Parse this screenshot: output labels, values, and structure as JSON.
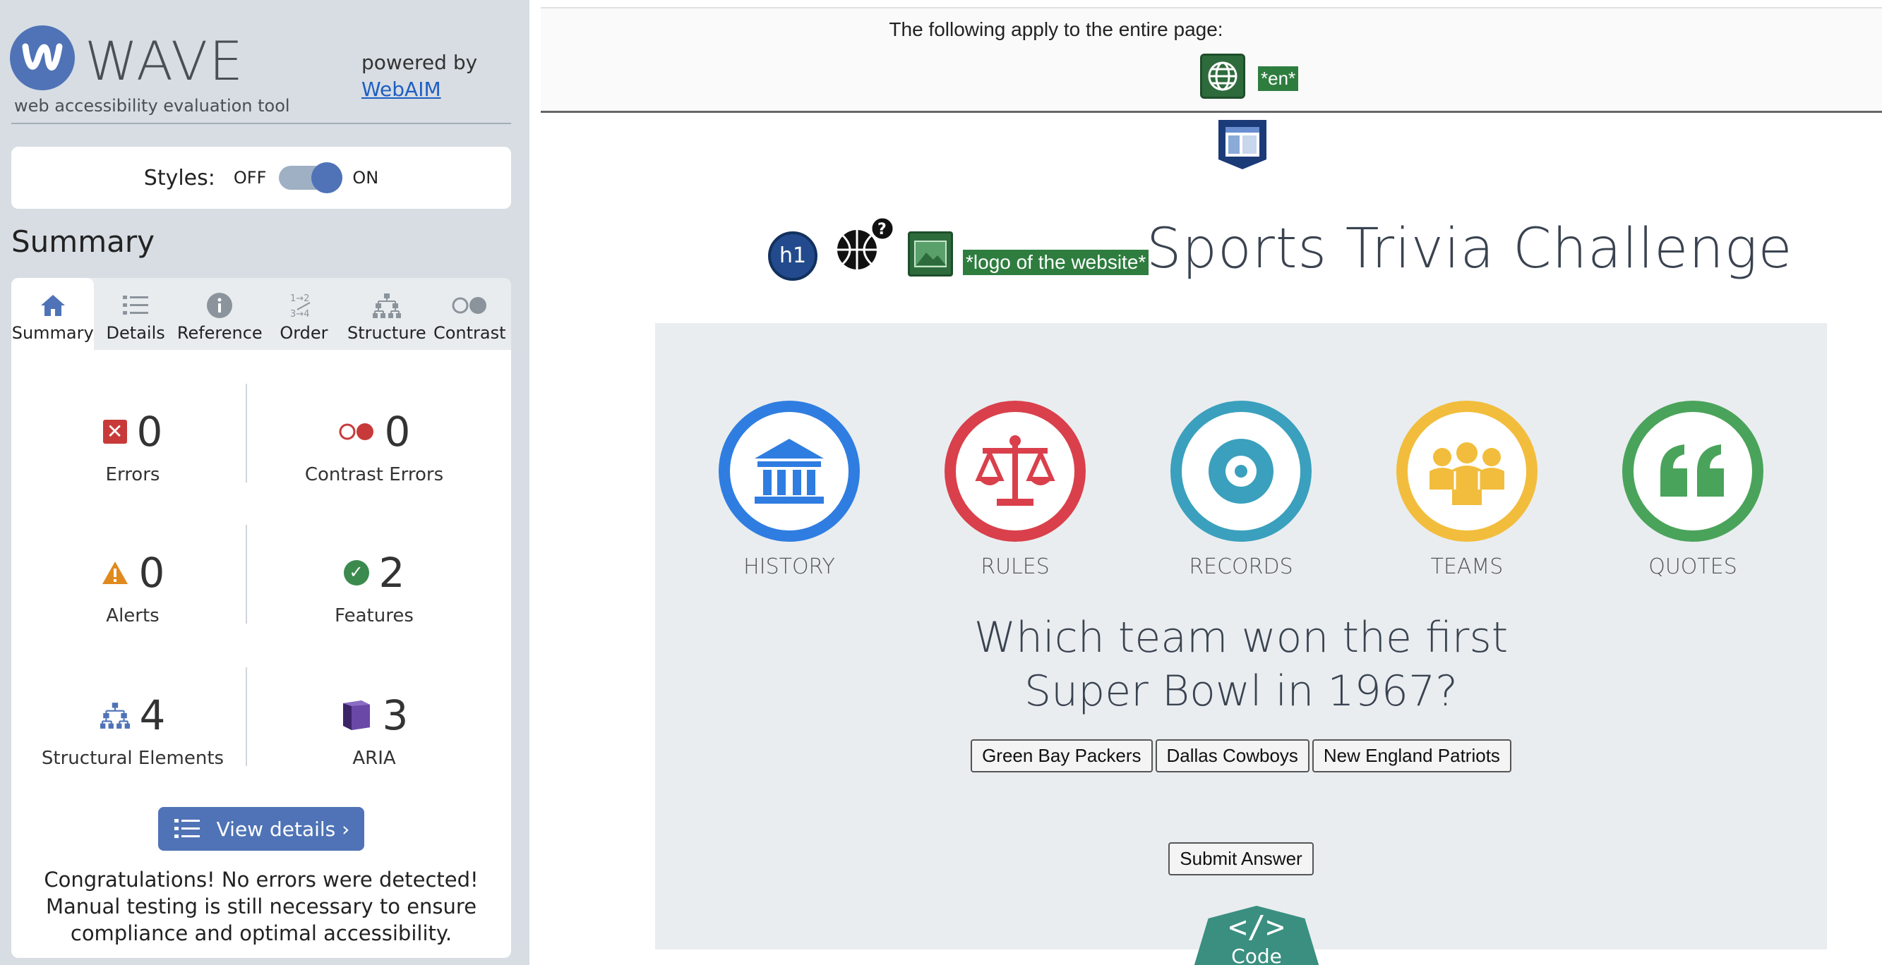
{
  "sidebar": {
    "brand": "WAVE",
    "tagline": "web accessibility evaluation tool",
    "powered_by": "powered by",
    "webaim_link": "WebAIM",
    "styles_label": "Styles:",
    "toggle_off": "OFF",
    "toggle_on": "ON",
    "toggle_state": "on",
    "summary_heading": "Summary",
    "tabs": [
      {
        "label": "Summary",
        "icon": "home-icon",
        "active": true
      },
      {
        "label": "Details",
        "icon": "list-icon",
        "active": false
      },
      {
        "label": "Reference",
        "icon": "info-icon",
        "active": false
      },
      {
        "label": "Order",
        "icon": "order-icon",
        "active": false
      },
      {
        "label": "Structure",
        "icon": "structure-icon",
        "active": false
      },
      {
        "label": "Contrast",
        "icon": "contrast-icon",
        "active": false
      }
    ],
    "stats": {
      "errors": {
        "count": "0",
        "label": "Errors"
      },
      "contrast_errors": {
        "count": "0",
        "label": "Contrast Errors"
      },
      "alerts": {
        "count": "0",
        "label": "Alerts"
      },
      "features": {
        "count": "2",
        "label": "Features"
      },
      "structural": {
        "count": "4",
        "label": "Structural Elements"
      },
      "aria": {
        "count": "3",
        "label": "ARIA"
      }
    },
    "view_details": "View details ›",
    "congrats": "Congratulations! No errors were detected! Manual testing is still necessary to ensure compliance and optimal accessibility."
  },
  "page": {
    "top_note": "The following apply to the entire page:",
    "lang_tag": "*en*",
    "logo_alt": "*logo of the website*",
    "h1_badge": "h1",
    "title": "Sports Trivia Challenge",
    "categories": [
      {
        "label": "HISTORY",
        "color": "#2f7de1",
        "icon": "bank-icon"
      },
      {
        "label": "RULES",
        "color": "#d9404b",
        "icon": "scale-icon"
      },
      {
        "label": "RECORDS",
        "color": "#3aa0bd",
        "icon": "target-icon"
      },
      {
        "label": "TEAMS",
        "color": "#f2bd3c",
        "icon": "people-icon"
      },
      {
        "label": "QUOTES",
        "color": "#4aa35a",
        "icon": "quote-icon"
      }
    ],
    "question_line1": "Which team won the first",
    "question_line2": "Super Bowl in 1967?",
    "answers": [
      "Green Bay Packers",
      "Dallas Cowboys",
      "New England Patriots"
    ],
    "submit": "Submit Answer",
    "code_tab": "Code"
  },
  "colors": {
    "wave_blue": "#4f73b6",
    "error_red": "#c83a3a",
    "feature_green": "#3b8a4e",
    "aria_purple": "#5a3b8a",
    "alert_orange": "#e08a1e"
  }
}
